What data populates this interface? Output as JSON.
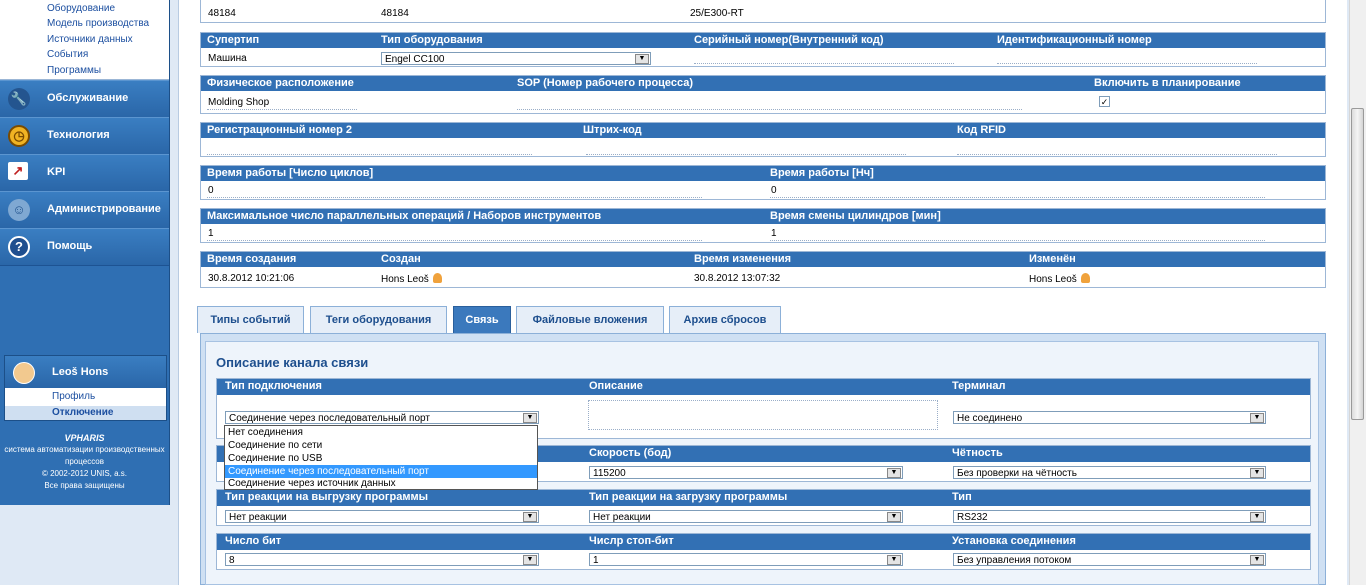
{
  "sidebar": {
    "submenu": [
      "Оборудование",
      "Модель производства",
      "Источники данных",
      "События",
      "Программы"
    ],
    "nav": [
      {
        "label": "Обслуживание",
        "icon": "wrench-icon"
      },
      {
        "label": "Технология",
        "icon": "clock-icon"
      },
      {
        "label": "KPI",
        "icon": "chart-icon"
      },
      {
        "label": "Администрирование",
        "icon": "users-icon"
      },
      {
        "label": "Помощь",
        "icon": "help-icon"
      }
    ],
    "user": {
      "name": "Leoš Hons",
      "profile": "Профиль",
      "logout": "Отключение"
    },
    "footer": {
      "brand": "VPHARIS",
      "line1": "система автоматизации производственных процессов",
      "copyright": "© 2002-2012 UNIS, a.s.",
      "rights": "Все права защищены"
    }
  },
  "top_row": {
    "v1": "48184",
    "v2": "48184",
    "v3": "25/E300-RT"
  },
  "s_type": {
    "h_supertype": "Супертип",
    "h_eqtype": "Тип оборудования",
    "h_serial": "Серийный номер(Внутренний код)",
    "h_ident": "Идентификационный номер",
    "supertype": "Машина",
    "eqtype": "Engel CC100"
  },
  "s_loc": {
    "h_phys": "Физическое расположение",
    "h_sop": "SOP (Номер рабочего процесса)",
    "h_plan": "Включить в планирование",
    "phys": "Molding Shop",
    "plan_checked": "✓"
  },
  "s_reg": {
    "h_reg": "Регистрационный номер 2",
    "h_barcode": "Штрих-код",
    "h_rfid": "Код RFID"
  },
  "s_work": {
    "h_cycles": "Время работы [Число циклов]",
    "h_hours": "Время работы [Нч]",
    "cycles": "0",
    "hours": "0"
  },
  "s_par": {
    "h_max": "Максимальное число параллельных операций / Наборов инструментов",
    "h_change": "Время смены цилиндров [мин]",
    "max": "1",
    "change": "1"
  },
  "s_time": {
    "h_created": "Время создания",
    "h_creator": "Создан",
    "h_modified": "Время изменения",
    "h_modifier": "Изменён",
    "created": "30.8.2012 10:21:06",
    "creator": "Hons Leoš",
    "modified": "30.8.2012 13:07:32",
    "modifier": "Hons Leoš"
  },
  "tabs": [
    "Типы событий",
    "Теги оборудования",
    "Связь",
    "Файловые вложения",
    "Архив сбросов"
  ],
  "panel": {
    "title": "Описание канала связи",
    "h_conn": "Тип подключения",
    "h_desc": "Описание",
    "h_term": "Терминал",
    "conn": "Соединение через последовательный порт",
    "term": "Не соединено",
    "h_speed": "Скорость (бод)",
    "h_parity": "Чётность",
    "speed": "115200",
    "parity": "Без проверки на чётность",
    "h_unload": "Тип реакции на выгрузку программы",
    "h_load": "Тип реакции на загрузку программы",
    "h_type": "Тип",
    "unload": "Нет реакции",
    "load": "Нет реакции",
    "type": "RS232",
    "h_bits": "Число бит",
    "h_stop": "Числр стоп-бит",
    "h_setup": "Установка соединения",
    "bits": "8",
    "stop": "1",
    "setup": "Без управления потоком"
  },
  "dropdown_options": [
    "Нет соединения",
    "Соединение по сети",
    "Соединение по USB",
    "Соединение через последовательный порт",
    "Соединение через источник данных"
  ]
}
